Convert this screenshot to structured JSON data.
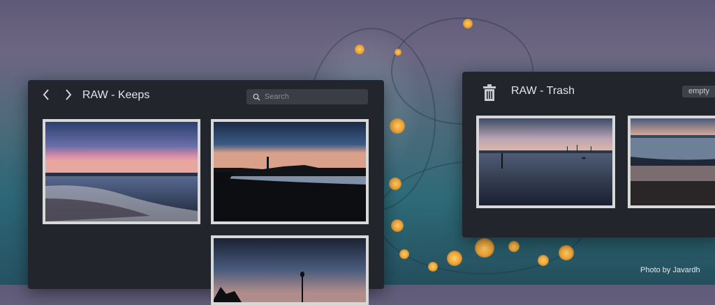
{
  "background": {
    "credit": "Photo by Javardh"
  },
  "keeps_window": {
    "back_icon": "chevron-left-icon",
    "forward_icon": "chevron-right-icon",
    "title": "RAW - Keeps",
    "search": {
      "placeholder": "Search",
      "value": "",
      "icon": "search-icon"
    },
    "photos": [
      {
        "label": "sunset-beach-clouds"
      },
      {
        "label": "lighthouse-silhouette"
      },
      {
        "label": "dusk-lamp-post"
      }
    ]
  },
  "trash_window": {
    "icon": "trash-icon",
    "title": "RAW - Trash",
    "empty_label": "empty",
    "photos": [
      {
        "label": "calm-bay-dusk"
      },
      {
        "label": "shoreline-waves"
      }
    ]
  },
  "colors": {
    "window_bg": "#22252b",
    "thumb_frame": "#d8d8d8",
    "accent_light": "#f0a030"
  }
}
